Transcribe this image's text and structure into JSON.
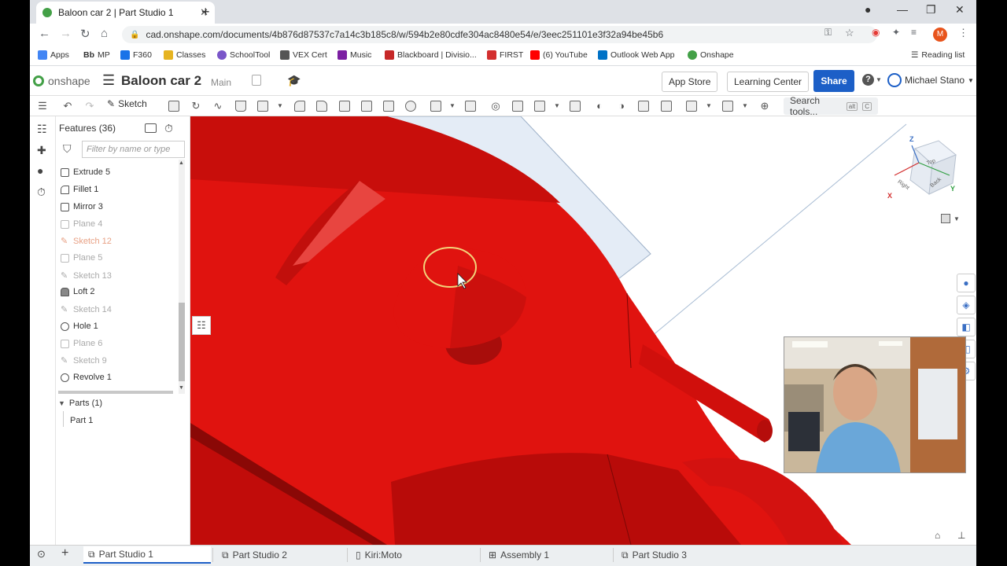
{
  "browser": {
    "tab_title": "Baloon car 2 | Part Studio 1",
    "url": "cad.onshape.com/documents/4b876d87537c7a14c3b185c8/w/594b2e80cdfe304ac8480e54/e/3eec251101e3f32a94be45b6",
    "profile_initial": "M",
    "bookmarks": [
      "Apps",
      "MP",
      "F360",
      "Classes",
      "SchoolTool",
      "VEX Cert",
      "Music",
      "Blackboard | Divisio...",
      "FIRST",
      "(6) YouTube",
      "Outlook Web App",
      "Onshape"
    ],
    "bookmark_colors": [
      "#4285f4",
      "#333333",
      "#1a73e8",
      "#e6b422",
      "#7a56c9",
      "#555555",
      "#7b1fa2",
      "#c62828",
      "#d32f2f",
      "#ff0000",
      "#0072c6",
      "#43a047"
    ],
    "bb_label": "Bb",
    "reading_list": "Reading list"
  },
  "app": {
    "logo_text": "onshape",
    "doc_name": "Baloon car 2",
    "branch": "Main",
    "app_store": "App Store",
    "learning_center": "Learning Center",
    "share": "Share",
    "user": "Michael Stano",
    "accent": "#1c5fc7"
  },
  "toolbar": {
    "sketch_label": "Sketch",
    "search_tools": "Search tools...",
    "shortcut_key1": "alt",
    "shortcut_key2": "C"
  },
  "features_panel": {
    "title": "Features (36)",
    "filter_placeholder": "Filter by name or type",
    "items": [
      {
        "label": "Extrude 5",
        "state": "normal"
      },
      {
        "label": "Fillet 1",
        "state": "normal"
      },
      {
        "label": "Mirror 3",
        "state": "normal"
      },
      {
        "label": "Plane 4",
        "state": "dim"
      },
      {
        "label": "Sketch 12",
        "state": "error"
      },
      {
        "label": "Plane 5",
        "state": "dim"
      },
      {
        "label": "Sketch 13",
        "state": "dim"
      },
      {
        "label": "Loft 2",
        "state": "normal"
      },
      {
        "label": "Sketch 14",
        "state": "dim"
      },
      {
        "label": "Hole 1",
        "state": "normal"
      },
      {
        "label": "Plane 6",
        "state": "dim"
      },
      {
        "label": "Sketch 9",
        "state": "dim"
      },
      {
        "label": "Revolve 1",
        "state": "normal"
      }
    ],
    "parts_header": "Parts (1)",
    "parts": [
      "Part 1"
    ]
  },
  "viewcube": {
    "axis_z": "Z",
    "axis_x": "X",
    "axis_y": "Y",
    "face_top": "Top",
    "face_back": "Back",
    "face_right": "Right"
  },
  "bottom_tabs": [
    "Part Studio 1",
    "Part Studio 2",
    "Kiri:Moto",
    "Assembly 1",
    "Part Studio 3"
  ],
  "model_color": "#e0130f"
}
